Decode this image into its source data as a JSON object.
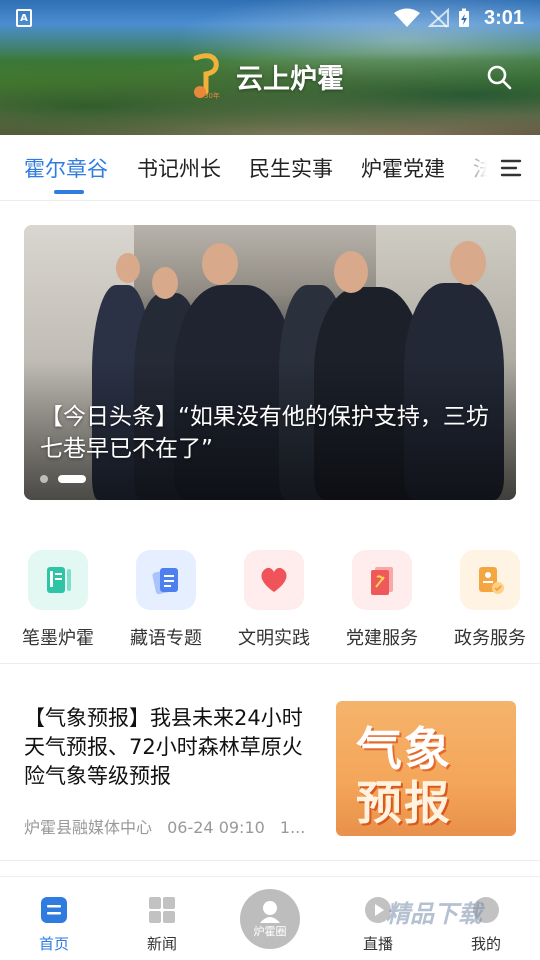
{
  "status_bar": {
    "sim_label": "A",
    "time": "3:01"
  },
  "header": {
    "title": "云上炉霍",
    "logo_text": "30年",
    "colors": {
      "accent": "#2f7be0"
    }
  },
  "tabs": {
    "items": [
      {
        "label": "霍尔章谷",
        "active": true
      },
      {
        "label": "书记州长",
        "active": false
      },
      {
        "label": "民生实事",
        "active": false
      },
      {
        "label": "炉霍党建",
        "active": false
      },
      {
        "label": "法",
        "active": false
      }
    ]
  },
  "banner": {
    "title": "【今日头条】“如果没有他的保护支持，三坊七巷早已不在了”",
    "slide_count": 2,
    "active_slide": 2
  },
  "entries": [
    {
      "label": "笔墨炉霍",
      "icon": "notebook-icon",
      "bg": "#e3f7f3",
      "fg": "#2fc4a6"
    },
    {
      "label": "藏语专题",
      "icon": "document-icon",
      "bg": "#e6efff",
      "fg": "#4d7ff0"
    },
    {
      "label": "文明实践",
      "icon": "heart-icon",
      "bg": "#ffecec",
      "fg": "#f0545a"
    },
    {
      "label": "党建服务",
      "icon": "party-book-icon",
      "bg": "#ffecec",
      "fg": "#ee5a5a"
    },
    {
      "label": "政务服务",
      "icon": "government-badge-icon",
      "bg": "#fff3e3",
      "fg": "#f4a640"
    }
  ],
  "news": {
    "title": "【气象预报】我县未来24小时天气预报、72小时森林草原火险气象等级预报",
    "source": "炉霍县融媒体中心",
    "time": "06-24 09:10",
    "extra": "1...",
    "thumb_line1": "气象",
    "thumb_line2": "预报"
  },
  "bottom_nav": {
    "items": [
      {
        "label": "首页",
        "icon": "home-icon",
        "active": true
      },
      {
        "label": "新闻",
        "icon": "grid-icon",
        "active": false
      },
      {
        "label": "炉霍圈",
        "icon": "community-icon",
        "active": false
      },
      {
        "label": "直播",
        "icon": "play-icon",
        "active": false
      },
      {
        "label": "我的",
        "icon": "profile-icon",
        "active": false
      }
    ]
  },
  "watermark": "精品下载"
}
